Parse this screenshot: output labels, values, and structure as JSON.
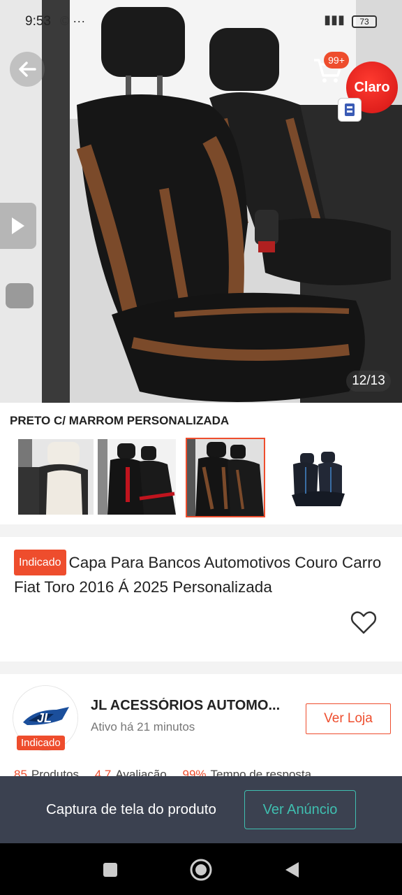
{
  "status_bar": {
    "time": "9:53",
    "extra": "© ···",
    "battery": "73"
  },
  "hero": {
    "image_counter": "12/13",
    "cart_badge": "99+",
    "carrier_badge": "Claro"
  },
  "variation": {
    "label": "PRETO C/ MARROM PERSONALIZADA",
    "selected_index": 2
  },
  "product": {
    "tag": "Indicado",
    "title": "Capa Para Bancos Automotivos Couro Carro Fiat Toro 2016 Á 2025 Personalizada"
  },
  "shop": {
    "name": "JL ACESSÓRIOS AUTOMO...",
    "status": "Ativo há 21 minutos",
    "tag": "Indicado",
    "visit_button": "Ver Loja",
    "stats": [
      {
        "value": "85",
        "label": "Produtos"
      },
      {
        "value": "4.7",
        "label": "Avaliação"
      },
      {
        "value": "99%",
        "label": "Tempo de resposta"
      }
    ]
  },
  "capture_bar": {
    "text": "Captura de tela do produto",
    "button": "Ver Anúncio"
  },
  "colors": {
    "accent": "#ee4d2d",
    "teal": "#3fbfb0",
    "bar": "#3b4150"
  }
}
